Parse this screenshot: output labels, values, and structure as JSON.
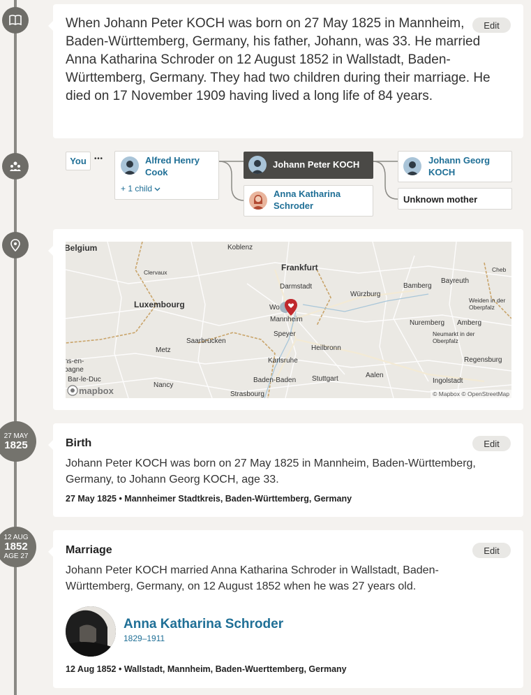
{
  "story": {
    "text": "When Johann Peter KOCH was born on 27 May 1825 in Mannheim, Baden-Württemberg, Germany, his father, Johann, was 33. He married Anna Katharina Schroder on 12 August 1852 in Wallstadt, Baden-Württemberg, Germany. They had two children during their marriage. He died on 17 November 1909 having lived a long life of 84 years.",
    "edit_label": "Edit"
  },
  "family": {
    "you_label": "You",
    "ellipsis": "• • •",
    "child": {
      "name": "Alfred Henry Cook",
      "more_children": "+ 1 child"
    },
    "self": {
      "name": "Johann Peter KOCH"
    },
    "spouse": {
      "name": "Anna Katharina Schroder"
    },
    "father": {
      "name": "Johann Georg KOCH"
    },
    "mother": {
      "name": "Unknown mother"
    }
  },
  "map": {
    "places": {
      "belgium": "Belgium",
      "koblenz": "Koblenz",
      "frankfurt": "Frankfurt",
      "cheb": "Cheb",
      "clervaux": "Clervaux",
      "darmstadt": "Darmstadt",
      "bamberg": "Bamberg",
      "bayreuth": "Bayreuth",
      "luxembourg": "Luxembourg",
      "wurzburg": "Würzburg",
      "weiden": "Weiden in der Oberpfalz",
      "worms": "Wo",
      "mannheim": "Mannheim",
      "nuremberg": "Nuremberg",
      "amberg": "Amberg",
      "speyer": "Speyer",
      "neumarkt": "Neumarkt in der Oberpfalz",
      "saarbrucken": "Saarbrücken",
      "heilbronn": "Heilbronn",
      "metz": "Metz",
      "karlsruhe": "Karlsruhe",
      "regensburg": "Regensburg",
      "chalons": "ns-en-pagne",
      "barleduc": "Bar-le-Duc",
      "nancy": "Nancy",
      "badenbaden": "Baden-Baden",
      "stuttgart": "Stuttgart",
      "aalen": "Aalen",
      "ingolstadt": "Ingolstadt",
      "strasbourg": "Strasbourg"
    },
    "logo": "mapbox",
    "attribution": "© Mapbox © OpenStreetMap"
  },
  "birth": {
    "date_day_month": "27 MAY",
    "date_year": "1825",
    "title": "Birth",
    "edit_label": "Edit",
    "text": "Johann Peter KOCH was born on 27 May 1825 in Mannheim, Baden-Württemberg, Germany, to Johann Georg KOCH, age 33.",
    "meta": "27 May 1825 • Mannheimer Stadtkreis, Baden-Württemberg, Germany"
  },
  "marriage": {
    "date_day_month": "12 AUG",
    "date_year": "1852",
    "age": "AGE 27",
    "title": "Marriage",
    "edit_label": "Edit",
    "text": "Johann Peter KOCH married Anna Katharina Schroder in Wallstadt, Baden-Württemberg, Germany, on 12 August 1852 when he was 27 years old.",
    "spouse_name": "Anna Katharina Schroder",
    "spouse_years": "1829–1911",
    "meta": "12 Aug 1852 • Wallstadt, Mannheim, Baden-Wuerttemberg, Germany"
  },
  "colors": {
    "link": "#1f6f96",
    "rail": "#8a8984",
    "pin": "#c0282d"
  }
}
